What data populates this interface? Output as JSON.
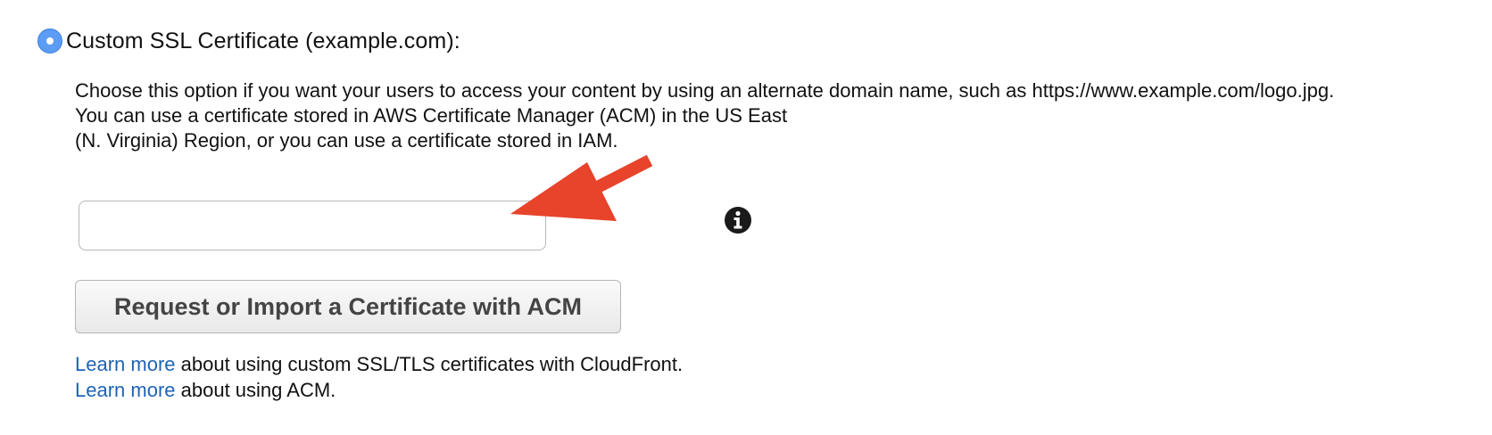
{
  "option": {
    "label": "Custom SSL Certificate (example.com):",
    "selected": true
  },
  "description": {
    "line1": "Choose this option if you want your users to access your content by using an alternate domain name, such as https://www.example.com/logo.jpg.",
    "line2": "You can use a certificate stored in AWS Certificate Manager (ACM) in the US East",
    "line3": "(N. Virginia) Region, or you can use a certificate stored in IAM."
  },
  "certificate_input": {
    "value": "",
    "placeholder": ""
  },
  "acm_button": {
    "label": "Request or Import a Certificate with ACM"
  },
  "learn_more": [
    {
      "link": "Learn more",
      "text": " about using custom SSL/TLS certificates with CloudFront."
    },
    {
      "link": "Learn more",
      "text": " about using ACM."
    }
  ],
  "icons": {
    "radio": "radio-selected-icon",
    "info": "info-icon",
    "annotation": "red-arrow-icon"
  },
  "colors": {
    "radio_fill": "#5b9df5",
    "link": "#1f63b4",
    "arrow": "#e8432b",
    "button_text": "#444444"
  }
}
